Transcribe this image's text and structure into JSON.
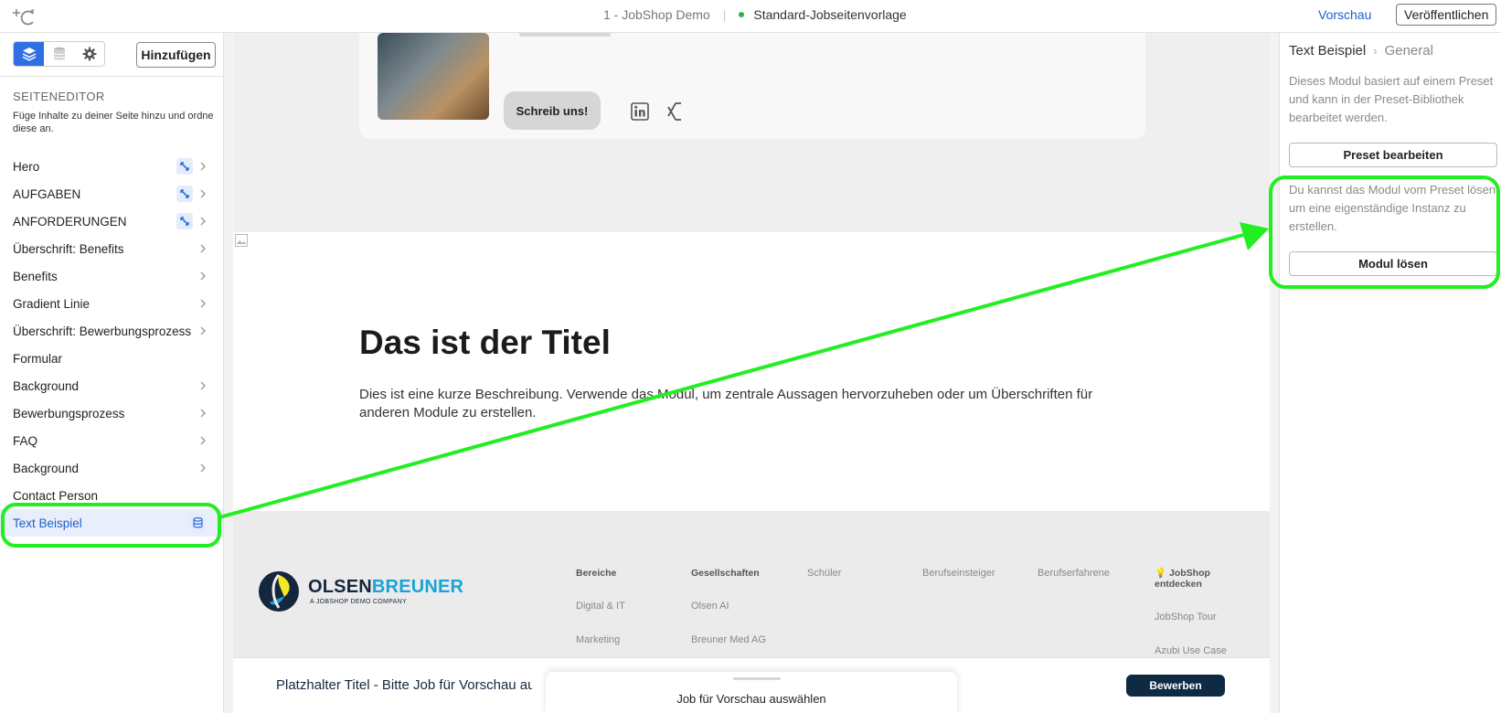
{
  "topbar": {
    "project": "1 - JobShop Demo",
    "separator": "|",
    "template": "Standard-Jobseitenvorlage",
    "preview_label": "Vorschau",
    "publish_label": "Veröffentlichen",
    "status_color": "#2ab24b"
  },
  "sidebar": {
    "add_label": "Hinzufügen",
    "section_title": "SEITENEDITOR",
    "section_desc": "Füge Inhalte zu deiner Seite hinzu und ordne diese an.",
    "modules": [
      {
        "label": "Hero"
      },
      {
        "label": "AUFGABEN"
      },
      {
        "label": "ANFORDERUNGEN"
      },
      {
        "label": "Überschrift: Benefits"
      },
      {
        "label": "Benefits"
      },
      {
        "label": "Gradient Linie"
      },
      {
        "label": "Überschrift: Bewerbungsprozess"
      },
      {
        "label": "Formular"
      },
      {
        "label": "Background"
      },
      {
        "label": "Bewerbungsprozess"
      },
      {
        "label": "FAQ"
      },
      {
        "label": "Background"
      },
      {
        "label": "Contact Person"
      },
      {
        "label": "Text Beispiel"
      }
    ]
  },
  "canvas": {
    "card": {
      "contact_button": "Schreib uns!"
    },
    "text_module": {
      "title": "Das ist der Titel",
      "description": "Dies ist eine kurze Beschreibung. Verwende das Modul, um zentrale Aussagen hervorzuheben oder um Überschriften für anderen Module zu erstellen."
    },
    "footer": {
      "brand_part1": "OLSEN",
      "brand_part2": "BREUNER",
      "brand_sub": "A JOBSHOP DEMO COMPANY",
      "columns": [
        {
          "heading": "Bereiche",
          "items": [
            "Digital & IT",
            "Marketing"
          ]
        },
        {
          "heading": "Gesellschaften",
          "items": [
            "Olsen AI",
            "Breuner Med AG"
          ]
        },
        {
          "heading": "Schüler",
          "items": []
        },
        {
          "heading": "Berufseinsteiger",
          "items": []
        },
        {
          "heading": "Berufserfahrene",
          "items": []
        },
        {
          "heading": "💡 JobShop entdecken",
          "items": [
            "JobShop Tour",
            "Azubi Use Case"
          ]
        }
      ]
    },
    "sticky": {
      "title": "Platzhalter Titel - Bitte Job für Vorschau auswählen",
      "apply_label": "Bewerben",
      "popup_text": "Job für Vorschau auswählen"
    }
  },
  "panel": {
    "crumb_module": "Text Beispiel",
    "crumb_section": "General",
    "preset_info": "Dieses Modul basiert auf einem Preset und kann in der Preset-Bibliothek bearbeitet werden.",
    "edit_preset_label": "Preset bearbeiten",
    "detach_info": "Du kannst das Modul vom Preset lösen, um eine eigenständige Instanz zu erstellen.",
    "detach_label": "Modul lösen"
  },
  "colors": {
    "accent": "#2f6fe4",
    "annotation": "#22ee22",
    "brand_dark": "#15273d",
    "brand_blue": "#1aa3d8"
  }
}
